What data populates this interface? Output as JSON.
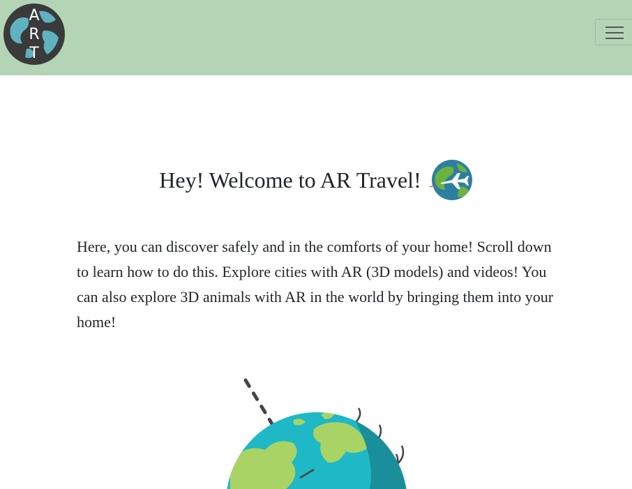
{
  "header": {
    "logo_letters": [
      "A",
      "R",
      "T"
    ],
    "logo_icon": "globe-logo-icon",
    "menu_icon": "hamburger-menu-icon"
  },
  "main": {
    "welcome_title": "Hey! Welcome to AR Travel!",
    "welcome_icon": "globe-airplane-icon",
    "intro_text": "Here, you can discover safely and in the comforts of your home! Scroll down to learn how to do this. Explore cities with AR (3D models) and videos! You can also explore 3D animals with AR in the world by bringing them into your home!",
    "illustration_icon": "earth-satellite-illustration"
  },
  "colors": {
    "navbar_bg": "#b4d4b6",
    "ocean": "#1fb8c6",
    "land": "#a9d465",
    "text": "#212529"
  }
}
